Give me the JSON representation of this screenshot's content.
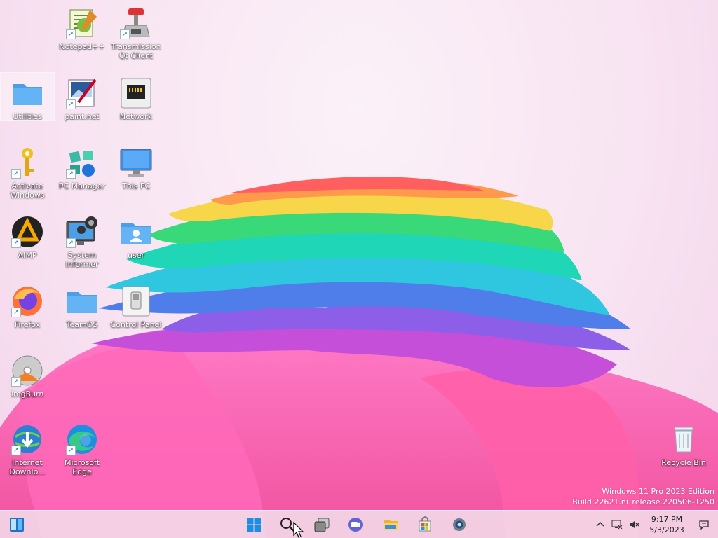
{
  "desktop_icons": [
    {
      "label": "Notepad++",
      "icon": "notepad-plus-icon",
      "shortcut": true
    },
    {
      "label": "Transmission Qt Client",
      "icon": "transmission-icon",
      "shortcut": true
    },
    {
      "label": "Utilities",
      "icon": "folder-icon",
      "shortcut": false,
      "selected": true
    },
    {
      "label": "paint.net",
      "icon": "paintnet-icon",
      "shortcut": true
    },
    {
      "label": "Network",
      "icon": "network-icon",
      "shortcut": false
    },
    {
      "label": "Activate Windows",
      "icon": "key-icon",
      "shortcut": true
    },
    {
      "label": "PC Manager",
      "icon": "pc-manager-icon",
      "shortcut": true
    },
    {
      "label": "This PC",
      "icon": "monitor-icon",
      "shortcut": false
    },
    {
      "label": "AIMP",
      "icon": "aimp-icon",
      "shortcut": true
    },
    {
      "label": "System Informer",
      "icon": "system-informer-icon",
      "shortcut": true
    },
    {
      "label": "user",
      "icon": "user-folder-icon",
      "shortcut": false
    },
    {
      "label": "Firefox",
      "icon": "firefox-icon",
      "shortcut": true
    },
    {
      "label": "TeamOS",
      "icon": "folder-icon",
      "shortcut": false
    },
    {
      "label": "Control Panel",
      "icon": "control-panel-icon",
      "shortcut": false
    },
    {
      "label": "ImgBurn",
      "icon": "imgburn-icon",
      "shortcut": true
    },
    {
      "label": "Internet Downlo...",
      "icon": "idm-icon",
      "shortcut": true
    },
    {
      "label": "Microsoft Edge",
      "icon": "edge-icon",
      "shortcut": true
    },
    {
      "label": "Recycle Bin",
      "icon": "recycle-bin-icon",
      "shortcut": false
    }
  ],
  "watermark": {
    "line1": "Windows 11 Pro 2023 Edition",
    "line2": "Build 22621.ni_release.220506-1250"
  },
  "taskbar": {
    "left_icon": "widgets-icon",
    "pinned": [
      "start-icon",
      "search-icon",
      "task-view-icon",
      "chat-icon",
      "file-explorer-icon",
      "microsoft-store-icon",
      "settings-icon"
    ]
  },
  "tray": {
    "time": "9:17 PM",
    "date": "5/3/2023",
    "icons": [
      "chevron-up-icon",
      "network-tray-icon",
      "volume-muted-icon",
      "notification-icon"
    ]
  }
}
